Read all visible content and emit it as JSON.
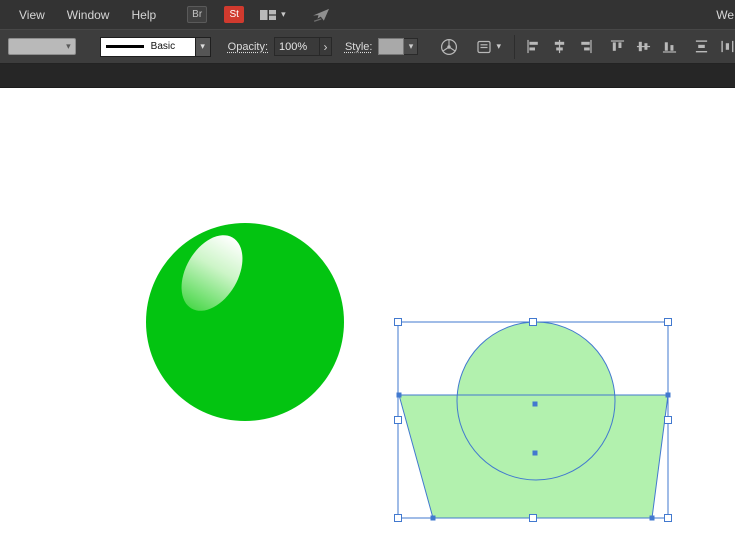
{
  "menubar": {
    "items": [
      {
        "label": "View"
      },
      {
        "label": "Window"
      },
      {
        "label": "Help"
      }
    ],
    "bridge_label": "Br",
    "stock_label": "St",
    "workspace_label": "We"
  },
  "controlbar": {
    "brush_name": "Basic",
    "opacity_label": "Opacity:",
    "opacity_value": "100%",
    "style_label": "Style:"
  },
  "colors": {
    "ball_green": "#03c411",
    "highlight_top": "#ffffff",
    "highlight_mid": "#cdf5c8",
    "highlight_bottom": "#4cd84c",
    "shape_fill": "#b2f1ae",
    "selection_blue": "#4279cf",
    "stock_red": "#d03a2e",
    "ui_dark": "#333333",
    "ui_mid": "#3d3d3d",
    "ui_strip": "#262626",
    "icon_gray": "#b9b9b9"
  }
}
